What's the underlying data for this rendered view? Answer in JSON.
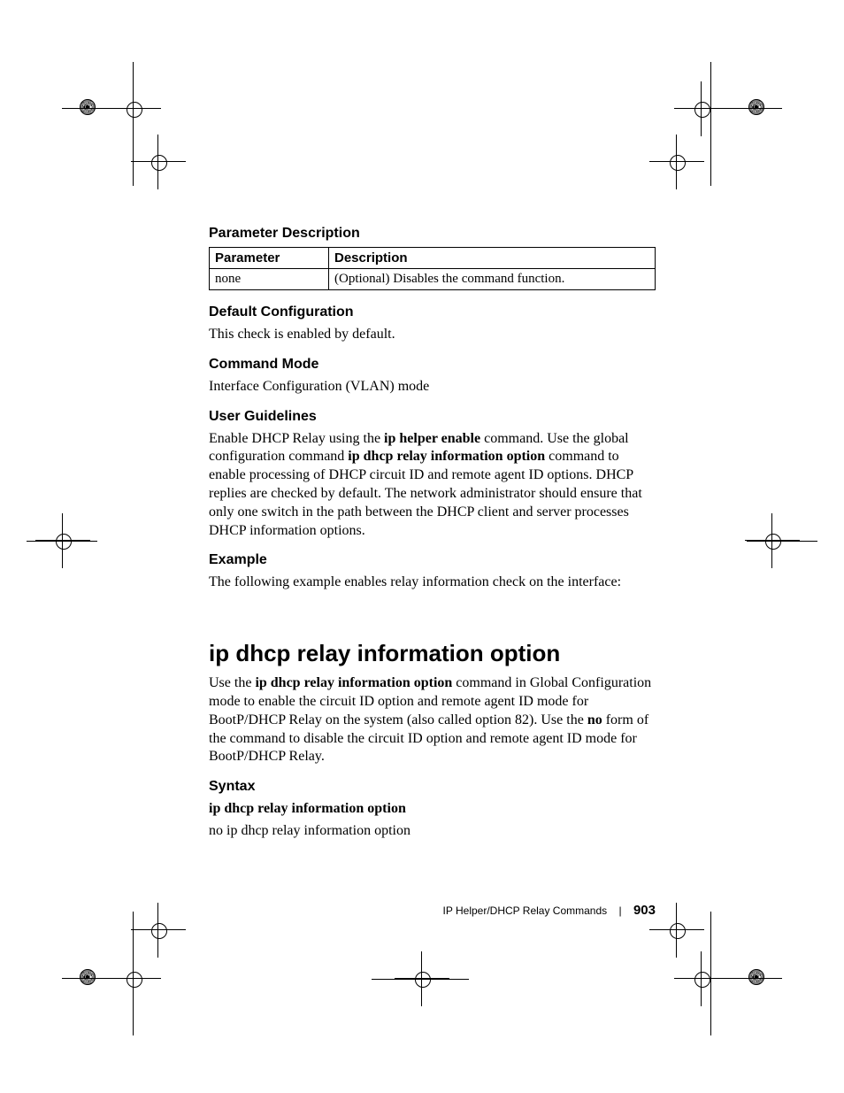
{
  "sections": {
    "param_desc": {
      "heading": "Parameter Description",
      "table": {
        "head": {
          "c1": "Parameter",
          "c2": "Description"
        },
        "row": {
          "c1": "none",
          "c2": "(Optional) Disables the command function."
        }
      }
    },
    "default_cfg": {
      "heading": "Default Configuration",
      "body": "This check is enabled by default."
    },
    "cmd_mode": {
      "heading": "Command Mode",
      "body": "Interface Configuration (VLAN) mode"
    },
    "user_guide": {
      "heading": "User Guidelines",
      "pre1": "Enable DHCP Relay using the ",
      "b1": "ip helper enable",
      "mid1": " command. Use the global configuration command ",
      "b2": "ip dhcp relay information option",
      "post1": " command to enable processing of DHCP circuit ID and remote agent ID options. DHCP replies are checked by default. The network administrator should ensure that only one switch in the path between the DHCP client and server processes DHCP information options."
    },
    "example": {
      "heading": "Example",
      "body": "The following example enables relay information check on the interface:"
    },
    "cmd": {
      "title": "ip dhcp relay information option",
      "pre1": "Use the ",
      "b1": "ip dhcp relay information option",
      "mid1": " command in Global Configuration mode to enable the circuit ID option and remote agent ID mode for BootP/DHCP Relay on the system (also called option 82). Use the ",
      "b2": "no",
      "post1": " form of the command to disable the circuit ID option and remote agent ID mode for BootP/DHCP Relay."
    },
    "syntax": {
      "heading": "Syntax",
      "l1": "ip dhcp relay information option",
      "l2": "no ip dhcp relay information option"
    }
  },
  "footer": {
    "section": "IP Helper/DHCP Relay Commands",
    "sep": "|",
    "page": "903"
  }
}
